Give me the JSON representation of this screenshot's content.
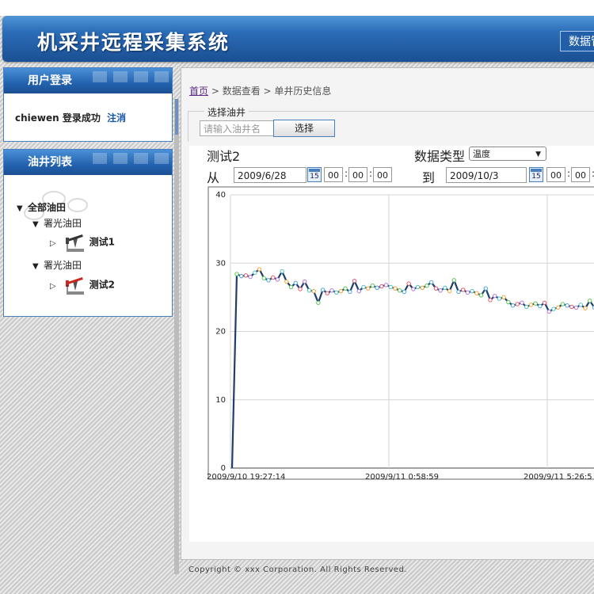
{
  "header": {
    "title": "机采井远程采集系统",
    "nav_button": "数据管"
  },
  "login_panel": {
    "title": "用户登录",
    "username": "chiewen",
    "status_text": "登录成功",
    "logout_label": "注消"
  },
  "well_panel": {
    "title": "油井列表",
    "tree": {
      "root": "全部油田",
      "groups": [
        {
          "label": "署光油田",
          "wells": [
            "测试1"
          ]
        },
        {
          "label": "署光油田",
          "wells": [
            "测试2"
          ]
        }
      ]
    }
  },
  "breadcrumb": {
    "home": "首页",
    "level2": "> 数据查看",
    "level3": "> 单井历史信息"
  },
  "select_well": {
    "legend": "选择油井",
    "placeholder": "请输入油井名",
    "button": "选择"
  },
  "query": {
    "well_name": "测试2",
    "data_type_label": "数据类型",
    "data_type_value": "温度",
    "from_label": "从",
    "from_date": "2009/6/28",
    "from_time": [
      "00",
      "00",
      "00"
    ],
    "to_label": "到",
    "to_date": "2009/10/3",
    "to_time": [
      "00",
      "00"
    ],
    "calendar_glyph": "15"
  },
  "chart_data": {
    "type": "line",
    "ylim": [
      0,
      40
    ],
    "yticks": [
      0,
      10,
      20,
      30,
      40
    ],
    "xtick_labels": [
      "2009/9/10 19:27:14",
      "2009/9/11 0:58:59",
      "2009/9/11 5:26:5"
    ],
    "series": [
      {
        "values": [
          0,
          28.4,
          28.1,
          28.2,
          28.0,
          28.6,
          29.1,
          27.8,
          27.5,
          27.9,
          27.6,
          28.8,
          27.3,
          26.5,
          27.1,
          26.2,
          27.3,
          26.0,
          25.9,
          24.2,
          26.1,
          25.6,
          26.0,
          25.7,
          25.9,
          26.3,
          25.8,
          27.4,
          25.9,
          26.5,
          26.3,
          26.7,
          26.4,
          26.6,
          26.8,
          26.5,
          26.3,
          26.0,
          25.8,
          27.0,
          26.2,
          26.5,
          26.4,
          26.7,
          27.2,
          26.3,
          26.0,
          26.4,
          25.9,
          27.5,
          25.8,
          26.1,
          25.7,
          25.9,
          25.6,
          25.3,
          26.3,
          24.6,
          25.2,
          24.8,
          25.0,
          24.3,
          23.8,
          24.0,
          24.2,
          23.6,
          23.9,
          24.1,
          23.7,
          24.2,
          22.9,
          23.3,
          23.5,
          24.0,
          23.8,
          23.6,
          23.5,
          23.9,
          23.4,
          24.5,
          23.5,
          25.1,
          23.6,
          24.8,
          24.3,
          24.6
        ]
      }
    ]
  },
  "footer": {
    "copyright": "Copyright © xxx Corporation. All Rights Reserved."
  }
}
